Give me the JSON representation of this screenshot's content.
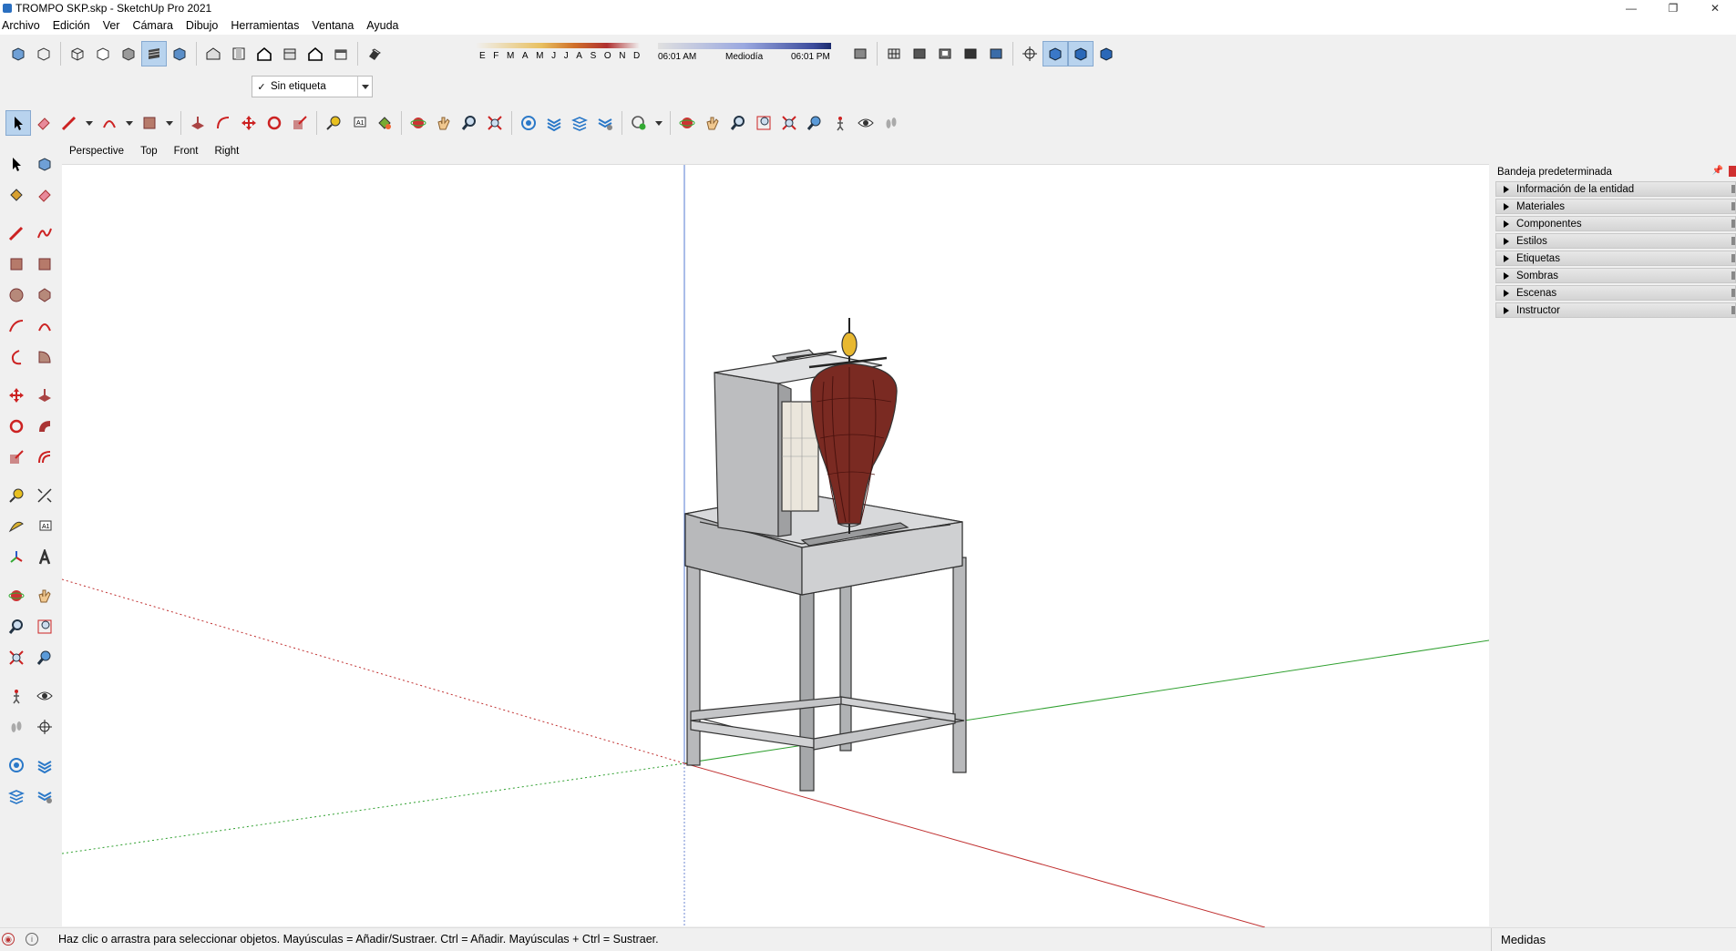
{
  "window": {
    "title": "TROMPO SKP.skp - SketchUp Pro 2021",
    "minimize": "—",
    "restore": "❐",
    "close": "✕"
  },
  "menu": [
    "Archivo",
    "Edición",
    "Ver",
    "Cámara",
    "Dibujo",
    "Herramientas",
    "Ventana",
    "Ayuda"
  ],
  "tag_selector": {
    "check": "✓",
    "value": "Sin etiqueta"
  },
  "shadows": {
    "months": "EFMAMJJASOND",
    "time_start": "06:01 AM",
    "time_mid": "Mediodía",
    "time_end": "06:01 PM"
  },
  "scene_tabs": [
    "Perspective",
    "Top",
    "Front",
    "Right"
  ],
  "tray": {
    "title": "Bandeja predeterminada",
    "pin": "📌",
    "panels": [
      "Información de la entidad",
      "Materiales",
      "Componentes",
      "Estilos",
      "Etiquetas",
      "Sombras",
      "Escenas",
      "Instructor"
    ]
  },
  "status": {
    "geo_icon": "◉",
    "info_icon": "i",
    "message": "Haz clic o arrastra para seleccionar objetos. Mayúsculas = Añadir/Sustraer. Ctrl = Añadir. Mayúsculas + Ctrl = Sustraer.",
    "measurements_label": "Medidas"
  },
  "colors": {
    "accent": "#b8d3ee",
    "axis_red": "#c03030",
    "axis_green": "#30a030",
    "meat": "#7a2a22",
    "steel": "#a6a8aa"
  }
}
